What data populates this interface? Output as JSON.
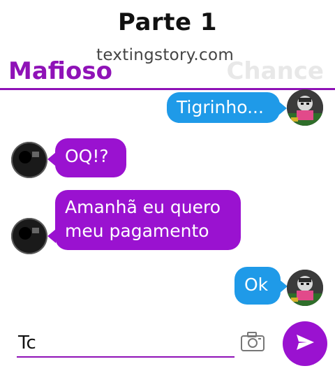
{
  "header": {
    "title": "Parte 1",
    "watermark": "textingstory.com",
    "contact_left": "Mafioso",
    "contact_right": "Chance"
  },
  "messages": [
    {
      "side": "right",
      "text": "Tigrinho..."
    },
    {
      "side": "left",
      "text": "OQ!?"
    },
    {
      "side": "left",
      "text": "Amanhã eu quero meu pagamento"
    },
    {
      "side": "right",
      "text": "Ok"
    }
  ],
  "composer": {
    "value": "Tc"
  },
  "colors": {
    "accent_purple": "#9a12d0",
    "bubble_blue": "#1f9ae8"
  },
  "icons": {
    "camera": "camera-icon",
    "send": "send-icon"
  }
}
